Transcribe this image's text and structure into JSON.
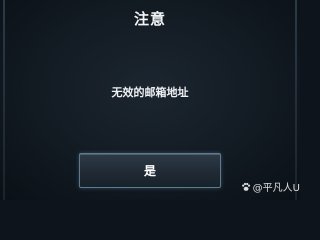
{
  "dialog": {
    "title": "注意",
    "message": "无效的邮箱地址",
    "confirm_label": "是"
  },
  "watermark": {
    "text": "@平凡人U",
    "icon": "paw-icon"
  },
  "colors": {
    "background": "#121a22",
    "button_border": "#5f7a90",
    "text": "#ffffff"
  }
}
